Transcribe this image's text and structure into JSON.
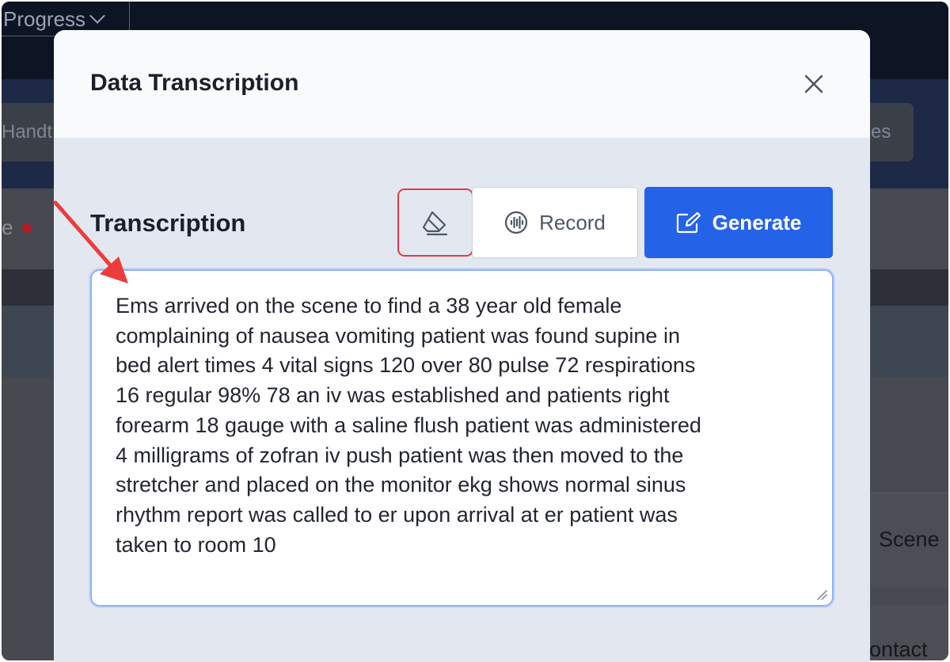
{
  "background": {
    "progress_label": "Progress",
    "handoff_partial": "Handt",
    "tab_partial": "es",
    "left_partial": "e",
    "scene_partial": "Scene",
    "contact_partial": "ontact"
  },
  "modal": {
    "title": "Data Transcription",
    "section_label": "Transcription",
    "record_label": "Record",
    "generate_label": "Generate",
    "transcript": "Ems arrived on the scene to find a 38 year old female\ncomplaining of nausea vomiting patient was found supine in\nbed alert times 4 vital signs 120 over 80 pulse 72 respirations\n16 regular 98% 78 an iv was established and patients right\nforearm 18 gauge with a saline flush patient was administered\n4 milligrams of zofran iv push patient was then moved to the\nstretcher and placed on the monitor ekg shows normal sinus\nrhythm report was called to er upon arrival at er patient was\ntaken to room 10"
  },
  "colors": {
    "primary": "#2463e8",
    "highlight": "#e23a48",
    "annotation_arrow": "#ee3b3b"
  },
  "icons": [
    "close-icon",
    "eraser-icon",
    "audio-wave-icon",
    "edit-icon",
    "resize-handle-icon"
  ]
}
